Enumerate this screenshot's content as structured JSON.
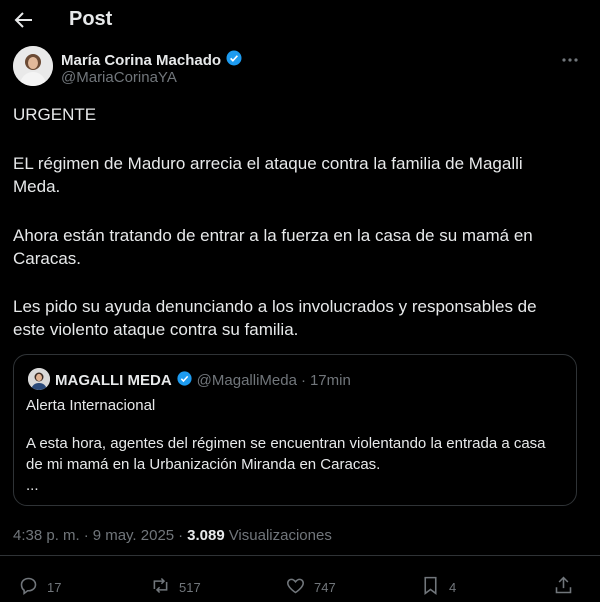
{
  "header": {
    "title": "Post"
  },
  "author": {
    "name": "María Corina Machado",
    "handle": "@MariaCorinaYA"
  },
  "post": {
    "lines": [
      "URGENTE",
      "EL régimen de Maduro arrecia el ataque contra la familia de Magalli",
      "Meda.",
      "Ahora están tratando de entrar a la fuerza en la casa de su mamá en",
      "Caracas.",
      "Les pido su ayuda denunciando a los involucrados y responsables de",
      "este violento ataque contra su familia."
    ]
  },
  "quote": {
    "name": "MAGALLI MEDA",
    "handle": "@MagalliMeda",
    "separator": "·",
    "time": "17min",
    "lines": [
      "Alerta Internacional",
      "A esta hora, agentes del régimen se encuentran violentando la entrada a casa",
      "de mi mamá en la Urbanización Miranda en Caracas.",
      "..."
    ]
  },
  "meta": {
    "time": "4:38 p. m.",
    "dot1": "·",
    "date": "9 may. 2025",
    "dot2": "·",
    "views_count": "3.089",
    "views_label": "Visualizaciones"
  },
  "actions": {
    "replies": "17",
    "reposts": "517",
    "likes": "747",
    "bookmarks": "4"
  },
  "colors": {
    "background": "#000000",
    "text": "#e7e9ea",
    "muted": "#71767b",
    "verified": "#1d9bf0",
    "border": "#2f3336"
  },
  "icons": [
    "back-arrow-icon",
    "verified-badge-icon",
    "more-icon",
    "reply-icon",
    "repost-icon",
    "like-icon",
    "bookmark-icon",
    "share-icon"
  ]
}
